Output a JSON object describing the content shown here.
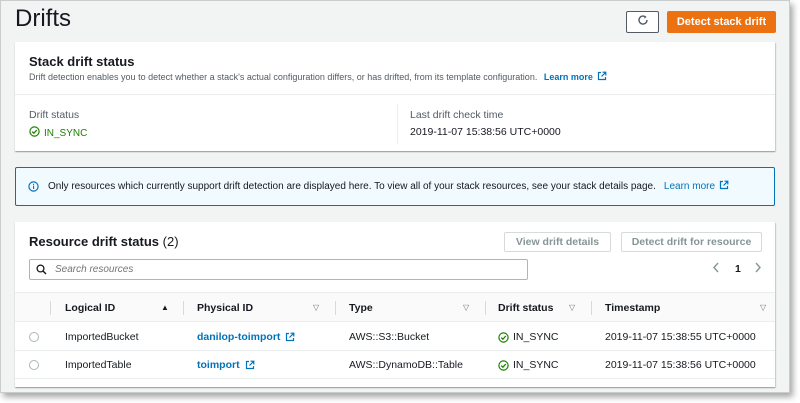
{
  "page": {
    "title": "Drifts"
  },
  "header": {
    "refresh_icon": "refresh-icon",
    "detect_label": "Detect stack drift"
  },
  "stack_status": {
    "title": "Stack drift status",
    "description": "Drift detection enables you to detect whether a stack's actual configuration differs, or has drifted, from its template configuration.",
    "learn_more": "Learn more",
    "drift_status_label": "Drift status",
    "drift_status_value": "IN_SYNC",
    "last_check_label": "Last drift check time",
    "last_check_value": "2019-11-07 15:38:56 UTC+0000"
  },
  "info": {
    "text": "Only resources which currently support drift detection are displayed here. To view all of your stack resources, see your stack details page.",
    "learn_more": "Learn more"
  },
  "resources": {
    "title": "Resource drift status",
    "count": "(2)",
    "view_details_label": "View drift details",
    "detect_resource_label": "Detect drift for resource",
    "search_placeholder": "Search resources",
    "page": "1",
    "columns": [
      "Logical ID",
      "Physical ID",
      "Type",
      "Drift status",
      "Timestamp"
    ],
    "rows": [
      {
        "logical_id": "ImportedBucket",
        "physical_id": "danilop-toimport",
        "type": "AWS::S3::Bucket",
        "drift": "IN_SYNC",
        "timestamp": "2019-11-07 15:38:55 UTC+0000"
      },
      {
        "logical_id": "ImportedTable",
        "physical_id": "toimport",
        "type": "AWS::DynamoDB::Table",
        "drift": "IN_SYNC",
        "timestamp": "2019-11-07 15:38:56 UTC+0000"
      }
    ]
  },
  "colors": {
    "primary": "#ec7211",
    "link": "#0073bb",
    "success": "#1d8102",
    "info_bg": "#f1faff"
  }
}
